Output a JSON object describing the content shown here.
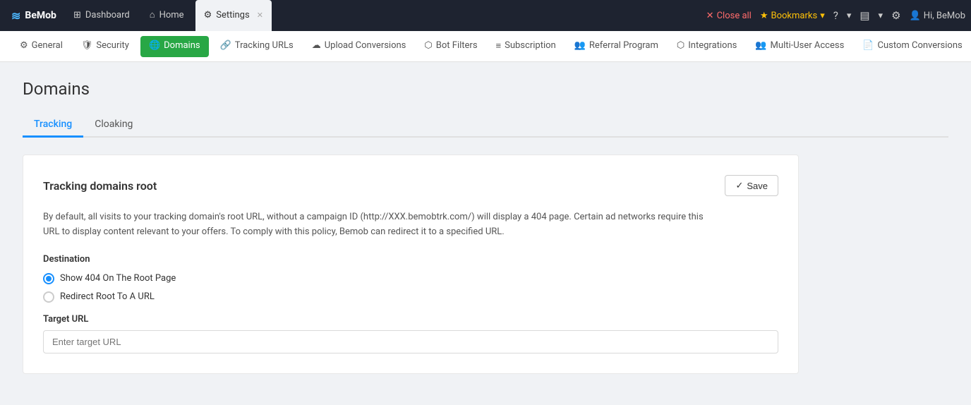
{
  "topbar": {
    "logo": "BeMob",
    "logo_icon": "≋",
    "tabs": [
      {
        "label": "Dashboard",
        "icon": "⊞",
        "active": false
      },
      {
        "label": "Home",
        "icon": "⌂",
        "active": false
      },
      {
        "label": "Settings",
        "icon": "⚙",
        "active": true,
        "closable": true
      }
    ],
    "close_all_label": "Close all",
    "bookmarks_label": "Bookmarks",
    "help_icon": "?",
    "notifications_icon": "▤",
    "settings_icon": "⚙",
    "user_label": "Hi, BeMob"
  },
  "navbar": {
    "items": [
      {
        "label": "General",
        "icon": "⚙"
      },
      {
        "label": "Security",
        "icon": "🛡"
      },
      {
        "label": "Domains",
        "icon": "🌐",
        "active": true
      },
      {
        "label": "Tracking URLs",
        "icon": "🔗"
      },
      {
        "label": "Upload Conversions",
        "icon": "☁"
      },
      {
        "label": "Bot Filters",
        "icon": "⬡"
      },
      {
        "label": "Subscription",
        "icon": "≡"
      },
      {
        "label": "Referral Program",
        "icon": "👥"
      },
      {
        "label": "Integrations",
        "icon": "⬡"
      },
      {
        "label": "Multi-User Access",
        "icon": "👥"
      },
      {
        "label": "Custom Conversions",
        "icon": "📄"
      }
    ]
  },
  "page": {
    "title": "Domains",
    "tabs": [
      {
        "label": "Tracking",
        "active": true
      },
      {
        "label": "Cloaking",
        "active": false
      }
    ]
  },
  "card": {
    "title": "Tracking domains root",
    "save_label": "Save",
    "save_icon": "✓",
    "description": "By default, all visits to your tracking domain's root URL, without a campaign ID (http://XXX.bemobtrk.com/) will display a 404 page. Certain ad networks require this URL to display content relevant to your offers. To comply with this policy, Bemob can redirect it to a specified URL.",
    "destination_label": "Destination",
    "radio_options": [
      {
        "label": "Show 404 On The Root Page",
        "checked": true
      },
      {
        "label": "Redirect Root To A URL",
        "checked": false
      }
    ],
    "target_url_label": "Target URL",
    "target_url_placeholder": "Enter target URL"
  }
}
